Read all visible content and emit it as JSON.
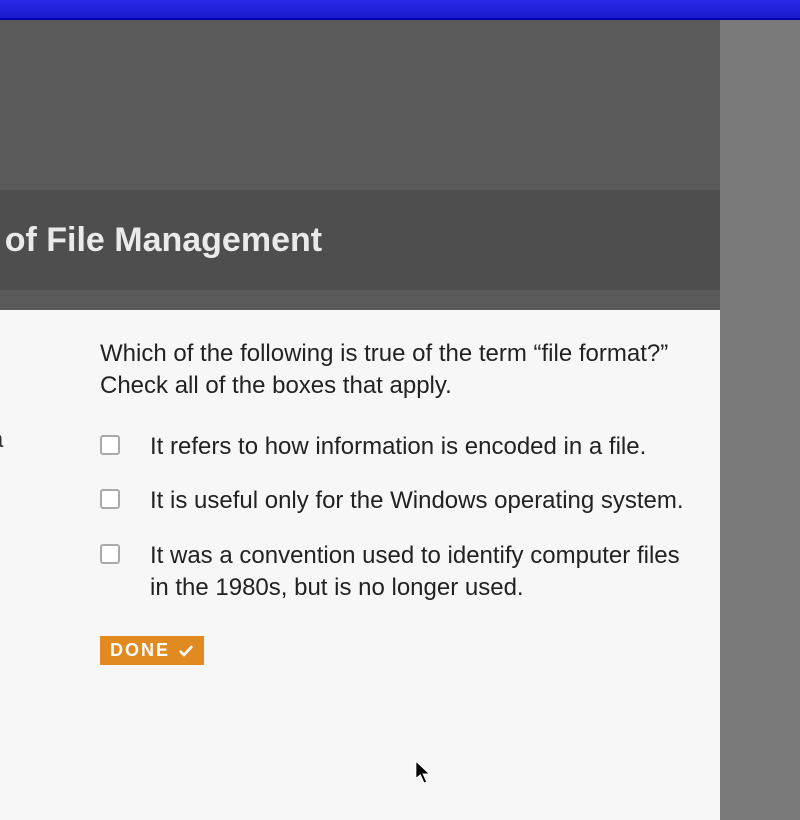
{
  "header": {
    "title_fragment": "wledge of File Management"
  },
  "side_text": "d a",
  "question": {
    "prompt": "Which of the following is true of the term “file format?” Check all of the boxes that apply.",
    "options": [
      {
        "label": "It refers to how information is encoded in a file.",
        "checked": false
      },
      {
        "label": "It is useful only for the Windows operating system.",
        "checked": false
      },
      {
        "label": "It was a convention used to identify computer files in the 1980s, but is no longer used.",
        "checked": false
      }
    ]
  },
  "buttons": {
    "done": "DONE"
  }
}
